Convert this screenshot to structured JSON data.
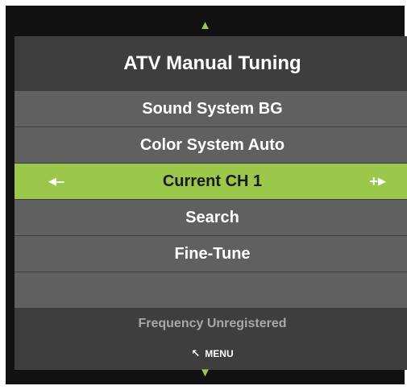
{
  "title": "ATV Manual Tuning",
  "nav": {
    "up_icon": "triangle-up-icon",
    "down_icon": "triangle-down-icon"
  },
  "menu": {
    "sound_system": "Sound System BG",
    "color_system": "Color System Auto",
    "current_channel": "Current CH 1",
    "search": "Search",
    "fine_tune": "Fine-Tune"
  },
  "current_controls": {
    "left_arrow": "◀",
    "left_sign": "–",
    "right_sign": "+",
    "right_arrow": "▶"
  },
  "status": "Frequency Unregistered",
  "hint": {
    "icon": "↖",
    "label": "MENU"
  },
  "colors": {
    "accent": "#9bc84a",
    "frame": "#111111",
    "panel": "#3e3e3e",
    "row": "#606060"
  }
}
